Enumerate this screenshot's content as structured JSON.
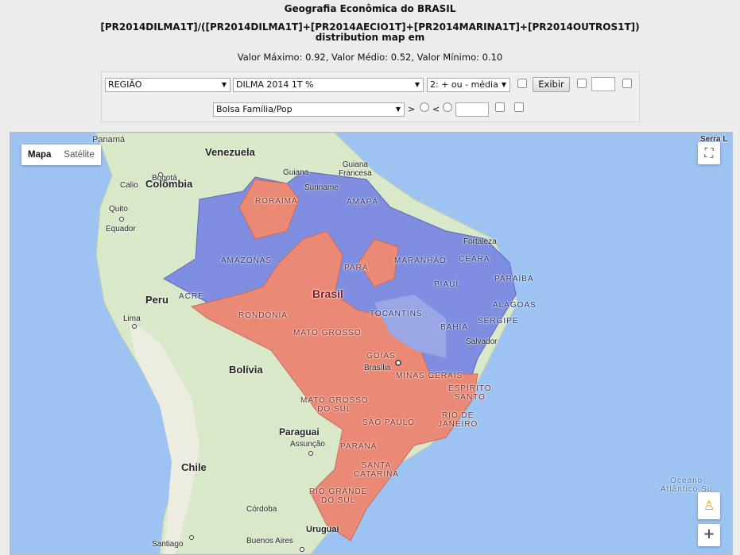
{
  "header": {
    "title": "Geografia Econômica do BRASIL",
    "formula": "[PR2014DILMA1T]/([PR2014DILMA1T]+[PR2014AECIO1T]+[PR2014MARINA1T]+[PR2014OUTROS1T])",
    "subtitle": "distribution map em",
    "stats": "Valor Máximo: 0.92, Valor Médio: 0.52, Valor Mínimo: 0.10"
  },
  "controls": {
    "region_select": "REGIÃO",
    "variable_select": "DILMA 2014 1T %",
    "mode_select": "2: + ou - média",
    "exibir_button": "Exibir",
    "filter_select": "Bolsa Família/Pop",
    "gt_label": ">",
    "lt_label": "<"
  },
  "map": {
    "type_buttons": [
      "Mapa",
      "Satélite"
    ],
    "zoom_in": "+",
    "colors": {
      "ocean": "#9cc3f2",
      "land": "#d8e8c8",
      "high": "#7f8ee0",
      "low": "#ea8a76"
    },
    "labels": {
      "panama": "Panamá",
      "serra": "Serra L",
      "venezuela": "Venezuela",
      "guiana": "Guiana",
      "guiana_fr": "Guiana\nFrancesa",
      "suriname": "Suriname",
      "bogota": "Bogotá",
      "calio": "Calio",
      "colombia": "Colômbia",
      "quito": "Quito",
      "equador": "Equador",
      "roraima": "RORAIMA",
      "amapa": "AMAPÁ",
      "amazonas": "AMAZONAS",
      "fortaleza": "Fortaleza",
      "maranhao": "MARANHÃO",
      "ceara": "CEARÁ",
      "para": "PARÁ",
      "paraiba": "PARAÍBA",
      "piaui": "PIAUÍ",
      "peru": "Peru",
      "acre": "ACRE",
      "brasil": "Brasil",
      "alagoas": "ALAGOAS",
      "rondonia": "RONDÔNIA",
      "tocantins": "TOCANTINS",
      "sergipe": "SERGIPE",
      "lima": "Lima",
      "bahia": "BAHIA",
      "mato_grosso": "MATO GROSSO",
      "salvador": "Salvador",
      "bolivia": "Bolívia",
      "goias": "GOIÁS",
      "brasilia": "Brasília",
      "minas": "MINAS GERAIS",
      "espirito": "ESPÍRITO\nSANTO",
      "ms": "MATO GROSSO\nDO SUL",
      "rio": "RIO DE\nJANEIRO",
      "paraguai": "Paraguai",
      "sao_paulo": "SÃO PAULO",
      "assuncao": "Assunção",
      "parana": "PARANÁ",
      "chile": "Chile",
      "santa": "SANTA\nCATARINA",
      "rgs": "RIO GRANDE\nDO SUL",
      "oceano": "Oceano\nAtlântico Su",
      "cordoba": "Córdoba",
      "uruguai": "Uruguai",
      "santiago": "Santiago",
      "buenos": "Buenos Aires"
    }
  }
}
